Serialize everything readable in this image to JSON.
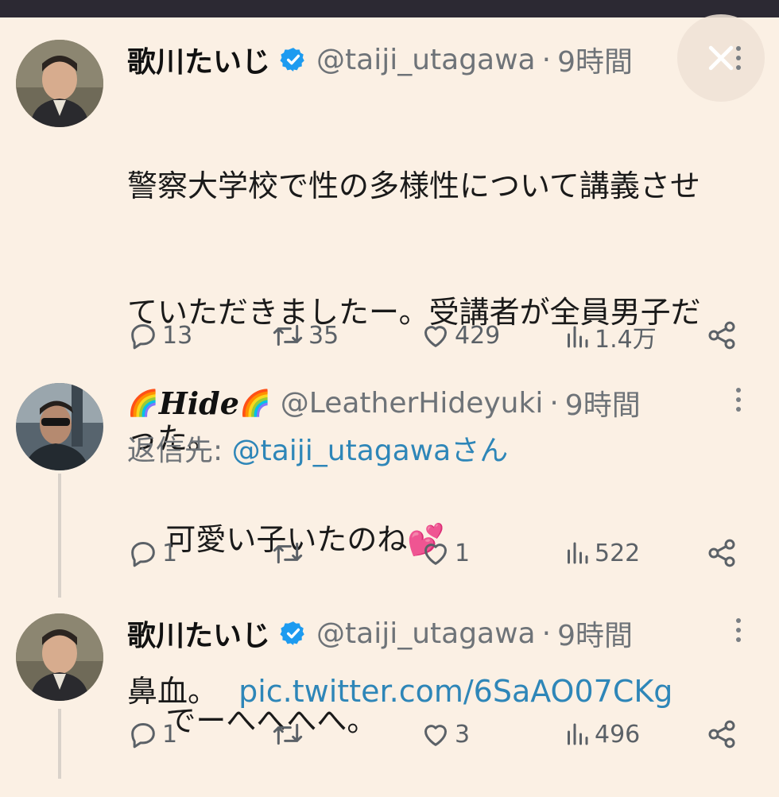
{
  "colors": {
    "background": "#fbf0e4",
    "link": "#2e86b8",
    "muted": "#6e7378",
    "verified": "#1d9bf0"
  },
  "tweets": [
    {
      "name": "歌川たいじ",
      "verified": true,
      "handle": "@taiji_utagawa",
      "separator": "·",
      "time": "9時間",
      "text_lines": [
        "警察大学校で性の多様性について講義させ",
        "ていただきましたー。受講者が全員男子だ",
        "った。"
      ],
      "text_last": "鼻血。",
      "link": "pic.twitter.com/6SaAO07CKg",
      "stats": {
        "replies": "13",
        "retweets": "35",
        "likes": "429",
        "views": "1.4万"
      }
    },
    {
      "name": "Hide",
      "name_prefix_emoji": "🌈",
      "name_suffix_emoji": "🌈",
      "handle": "@LeatherHideyuki",
      "separator": "·",
      "time": "9時間",
      "reply_to_label": "返信先:",
      "reply_to_handle": "@taiji_utagawa",
      "reply_to_suffix": "さん",
      "text": "可愛い子いたのね",
      "text_emoji": "💕",
      "stats": {
        "replies": "1",
        "retweets": "",
        "likes": "1",
        "views": "522"
      }
    },
    {
      "name": "歌川たいじ",
      "verified": true,
      "handle": "@taiji_utagawa",
      "separator": "·",
      "time": "9時間",
      "text": "でーへへへへ。",
      "stats": {
        "replies": "1",
        "retweets": "",
        "likes": "3",
        "views": "496"
      }
    }
  ],
  "icons": [
    "close-icon",
    "verified-badge-icon",
    "more-icon",
    "reply-icon",
    "retweet-icon",
    "like-icon",
    "views-icon",
    "share-icon"
  ]
}
